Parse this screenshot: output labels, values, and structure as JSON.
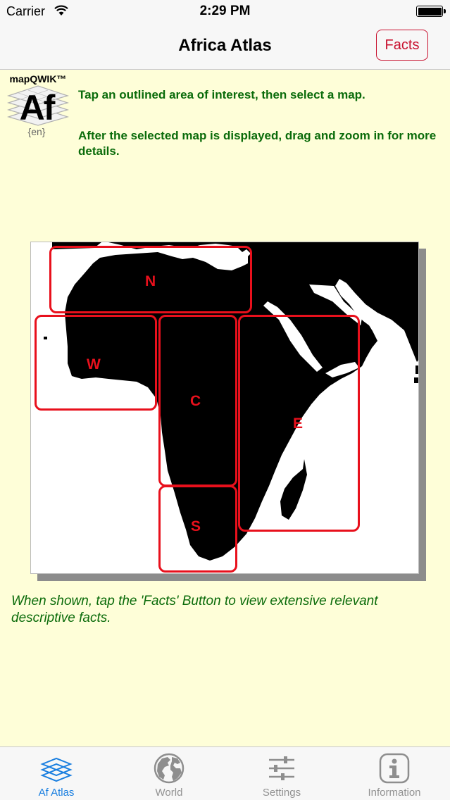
{
  "status_bar": {
    "carrier": "Carrier",
    "time": "2:29 PM"
  },
  "nav": {
    "title": "Africa Atlas",
    "facts_label": "Facts"
  },
  "logo": {
    "brand": "mapQWIK™",
    "letters": "Af",
    "lang": "{en}"
  },
  "instructions": {
    "line1": "Tap an outlined area of interest, then select a map.",
    "line2": "After the selected map is displayed, drag and zoom in for more details."
  },
  "map": {
    "regions": [
      {
        "id": "N",
        "label": "N"
      },
      {
        "id": "W",
        "label": "W"
      },
      {
        "id": "C",
        "label": "C"
      },
      {
        "id": "E",
        "label": "E"
      },
      {
        "id": "S",
        "label": "S"
      }
    ]
  },
  "footer_note": "When shown, tap the 'Facts' Button to view extensive relevant descriptive facts.",
  "tabs": [
    {
      "label": "Af Atlas",
      "icon": "layers-icon",
      "active": true
    },
    {
      "label": "World",
      "icon": "globe-icon",
      "active": false
    },
    {
      "label": "Settings",
      "icon": "sliders-icon",
      "active": false
    },
    {
      "label": "Information",
      "icon": "info-icon",
      "active": false
    }
  ],
  "colors": {
    "accent": "#1a7fe0",
    "facts": "#c8102e",
    "region": "#e8101c",
    "text_green": "#0a6b0a",
    "background": "#fefed8"
  }
}
